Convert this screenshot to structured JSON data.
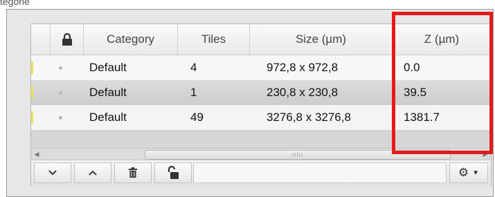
{
  "clip_label": "tegorie",
  "table": {
    "columns": [
      {
        "key": "lock",
        "label": "",
        "icon": "lock-icon"
      },
      {
        "key": "category",
        "label": "Category"
      },
      {
        "key": "tiles",
        "label": "Tiles"
      },
      {
        "key": "size",
        "label": "Size (µm)"
      },
      {
        "key": "z",
        "label": "Z (µm)"
      }
    ],
    "rows": [
      {
        "category": "Default",
        "tiles": "4",
        "size": "972,8 x 972,8",
        "z": "0.0"
      },
      {
        "category": "Default",
        "tiles": "1",
        "size": "230,8 x 230,8",
        "z": "39.5"
      },
      {
        "category": "Default",
        "tiles": "49",
        "size": "3276,8 x 3276,8",
        "z": "1381.7"
      }
    ]
  },
  "scrollbar": {
    "left_icon": "scroll-left-icon",
    "right_icon": "scroll-right-icon",
    "grip": "IIIII"
  },
  "toolbar": {
    "buttons": [
      {
        "name": "move-down-button",
        "icon": "chevron-down-icon"
      },
      {
        "name": "move-up-button",
        "icon": "chevron-up-icon"
      },
      {
        "name": "delete-button",
        "icon": "trash-icon"
      },
      {
        "name": "unlock-button",
        "icon": "unlock-icon"
      },
      {
        "name": "settings-menu-button",
        "icon": "gear-icon"
      }
    ]
  },
  "colors": {
    "highlight": "#e31b1b",
    "row_marker": "#e7e35e"
  }
}
